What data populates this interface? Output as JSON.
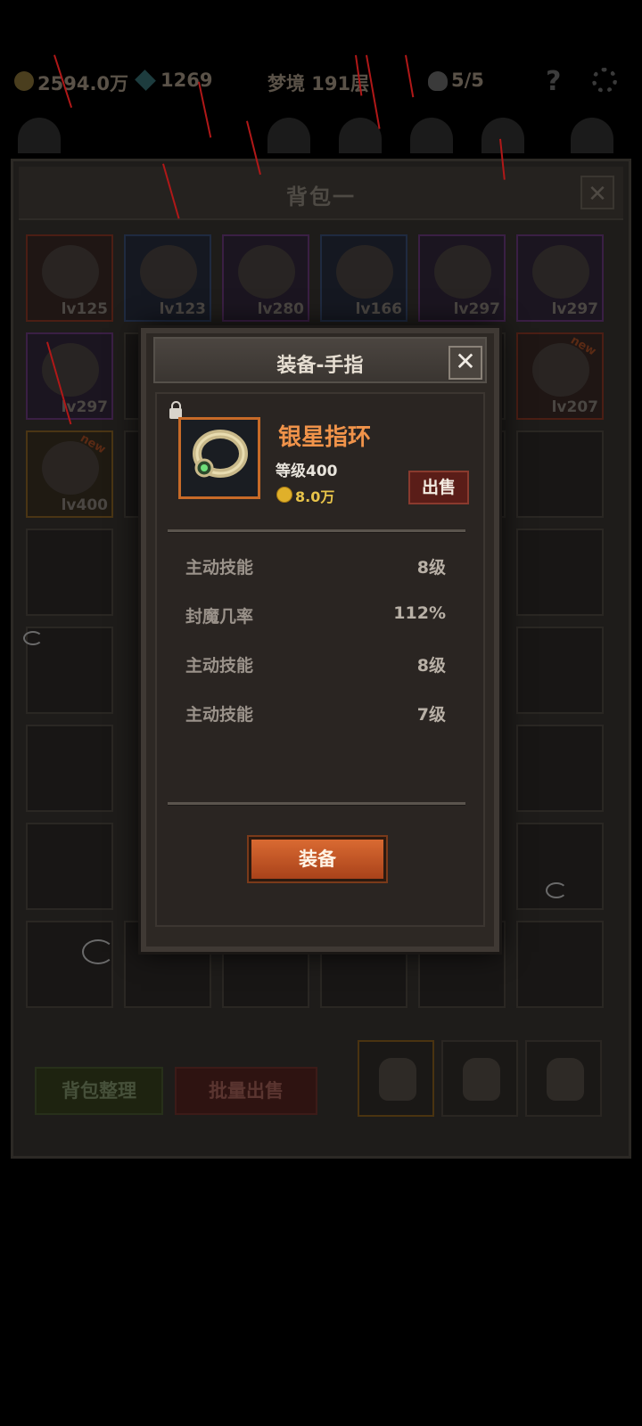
{
  "topbar": {
    "gold": "2594.0万",
    "gems": "1269",
    "stage": "梦境 191层",
    "skulls": "5/5",
    "help": "?"
  },
  "bag": {
    "title": "背包一",
    "close": "✕",
    "items": [
      {
        "lv": "lv125",
        "rarity": "red"
      },
      {
        "lv": "lv123",
        "rarity": "blue"
      },
      {
        "lv": "lv280",
        "rarity": "purple"
      },
      {
        "lv": "lv166",
        "rarity": "blue"
      },
      {
        "lv": "lv297",
        "rarity": "purple"
      },
      {
        "lv": "lv297",
        "rarity": "purple"
      },
      {
        "lv": "lv297",
        "rarity": "purple"
      },
      {
        "lv": "lv207",
        "rarity": "red",
        "new": "new"
      },
      {
        "lv": "lv400",
        "rarity": "orange",
        "new": "new"
      }
    ],
    "sort_button": "背包整理",
    "bulk_sell_button": "批量出售"
  },
  "modal": {
    "title": "装备-手指",
    "close": "✕",
    "item_name": "银星指环",
    "item_level": "等级400",
    "price": "8.0万",
    "sell": "出售",
    "stats": [
      {
        "label": "主动技能",
        "value": "8级"
      },
      {
        "label": "封魔几率",
        "value": "112%"
      },
      {
        "label": "主动技能",
        "value": "8级"
      },
      {
        "label": "主动技能",
        "value": "7级"
      }
    ],
    "equip": "装备"
  },
  "colors": {
    "accent_orange": "#f0934a",
    "sell_red": "#5a1d18",
    "equip_orange": "#d96a32",
    "rain_red": "#b01818"
  }
}
